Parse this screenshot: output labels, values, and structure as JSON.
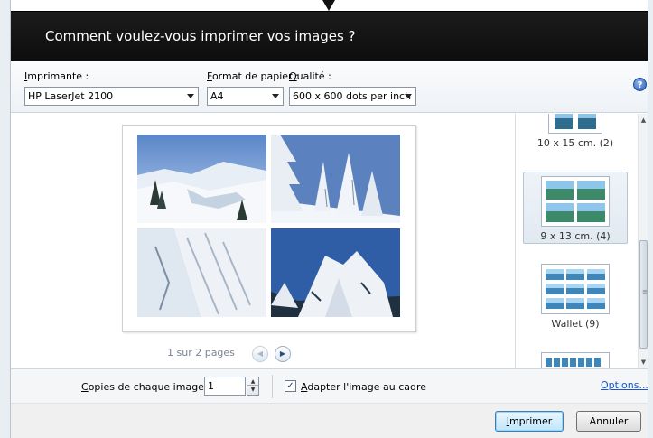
{
  "dialog": {
    "title": "Comment voulez-vous imprimer vos images ?"
  },
  "toolbar": {
    "printer_label_key": "I",
    "printer_label_rest": "mprimante :",
    "printer_value": "HP LaserJet 2100",
    "paper_label_key": "F",
    "paper_label_rest": "ormat de papier :",
    "paper_value": "A4",
    "quality_label_key": "Q",
    "quality_label_rest": "ualité :",
    "quality_value": "600 x 600 dots per inch",
    "help_glyph": "?"
  },
  "preview": {
    "pager_text": "1 sur 2 pages",
    "prev_glyph": "◀",
    "next_glyph": "▶",
    "photos": [
      "snow-landscape-photo",
      "snow-trees-sky-photo",
      "snowy-slope-photo",
      "snow-covered-tree-photo"
    ]
  },
  "layouts": {
    "items": [
      {
        "label": "10 x 15 cm. (2)",
        "selected": false
      },
      {
        "label": "9 x 13 cm. (4)",
        "selected": true
      },
      {
        "label": "Wallet (9)",
        "selected": false
      }
    ]
  },
  "scrollbar": {
    "up_glyph": "▲",
    "down_glyph": "▼",
    "grip_glyph": "≡"
  },
  "options": {
    "copies_label_key": "C",
    "copies_label_rest": "opies de chaque image :",
    "copies_value": "1",
    "spin_up": "▲",
    "spin_down": "▼",
    "fit_checked": true,
    "fit_check_glyph": "✓",
    "fit_label_key": "A",
    "fit_label_rest": "dapter l'image au cadre",
    "options_link": "Options..."
  },
  "buttons": {
    "print_key": "I",
    "print_rest": "mprimer",
    "cancel": "Annuler"
  },
  "colors": {
    "titlebar": "#111111",
    "link": "#1a56c7",
    "sky": "#4f77b3"
  }
}
